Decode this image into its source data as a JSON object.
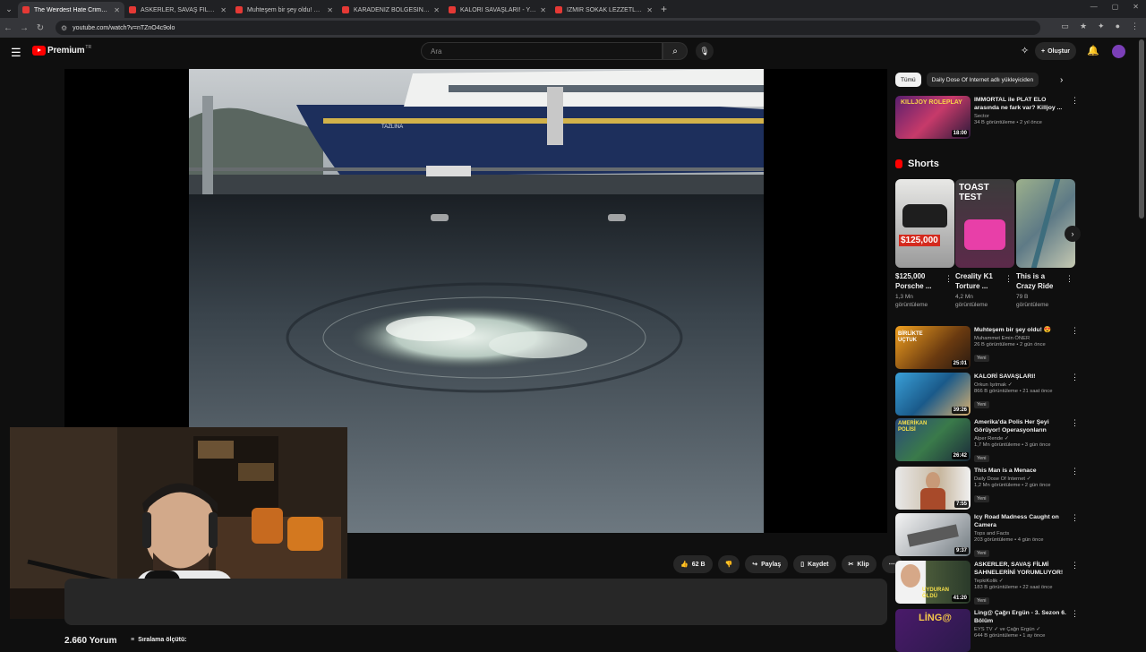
{
  "browser": {
    "tabs": [
      {
        "title": "The Weirdest Hate Crime - YouTube",
        "active": true
      },
      {
        "title": "ASKERLER, SAVAŞ FİLMİ SAHNE",
        "active": false
      },
      {
        "title": "Muhteşem bir şey oldu! 😍 - YouTube",
        "active": false
      },
      {
        "title": "KARADENİZ BÖLGESİNİN EN Ç",
        "active": false
      },
      {
        "title": "KALORİ SAVAŞLARI! - YouTube",
        "active": false
      },
      {
        "title": "İZMİR SOKAK LEZZETLERİ - You",
        "active": false
      }
    ],
    "url": "youtube.com/watch?v=nTZnO4c9olo"
  },
  "header": {
    "logo_text": "Premium",
    "logo_sup": "TR",
    "search_placeholder": "Ara",
    "create_label": "Oluştur"
  },
  "video": {
    "ship_name": "TAZLINA",
    "likes": "62 B",
    "share_label": "Paylaş",
    "save_label": "Kaydet",
    "clip_label": "Klip",
    "comments_count": "2.660 Yorum",
    "sort_label": "Sıralama ölçütü:"
  },
  "sidebar": {
    "chips": [
      "Tümü",
      "Daily Dose Of Internet adlı yükleyiciden"
    ],
    "top_rec": {
      "title": "IMMORTAL ile PLAT ELO arasında ne fark var? Killjoy ...",
      "channel": "Sector",
      "meta": "34 B görüntüleme • 2 yıl önce",
      "duration": "18:00",
      "thumb_text": "KILLJOY ROLEPLAY"
    },
    "shorts_title": "Shorts",
    "shorts": [
      {
        "title": "$125,000 Porsche ...",
        "views": "1,3 Mn görüntüleme",
        "thumb_text": "$125,000"
      },
      {
        "title": "Creality K1 Torture ...",
        "views": "4,2 Mn görüntüleme",
        "thumb_text": "TOAST TEST"
      },
      {
        "title": "This is a Crazy Ride",
        "views": "79 B görüntüleme",
        "thumb_text": ""
      }
    ],
    "recs": [
      {
        "title": "Muhteşem bir şey oldu! 😍",
        "channel": "Muhammet Emin ÖNER",
        "meta": "26 B görüntüleme • 2 gün önce",
        "badge": "Yeni",
        "duration": "25:01",
        "thumb_text": "BİRLİKTE UÇTUK"
      },
      {
        "title": "KALORİ SAVAŞLARI!",
        "channel": "Orkun Işıtmak ✓",
        "meta": "866 B görüntüleme • 21 saat önce",
        "badge": "Yeni",
        "duration": "39:26",
        "thumb_text": ""
      },
      {
        "title": "Amerika'da Polis Her Şeyi Görüyor! Operasyonların Perde...",
        "channel": "Alper Rende ✓",
        "meta": "1,7 Mn görüntüleme • 3 gün önce",
        "badge": "Yeni",
        "duration": "26:42",
        "thumb_text": "AMERİKAN POLİSİ"
      },
      {
        "title": "This Man is a Menace",
        "channel": "Daily Dose Of Internet ✓",
        "meta": "1,2 Mn görüntüleme • 2 gün önce",
        "badge": "Yeni",
        "duration": "7:55",
        "thumb_text": ""
      },
      {
        "title": "Icy Road Madness Caught on Camera",
        "channel": "Tops and Facts",
        "meta": "203 görüntüleme • 4 gün önce",
        "badge": "Yeni",
        "duration": "9:37",
        "thumb_text": ""
      },
      {
        "title": "ASKERLER, SAVAŞ FİLMİ SAHNELERİNİ YORUMLUYOR!",
        "channel": "TepkiKolik ✓",
        "meta": "183 B görüntüleme • 22 saat önce",
        "badge": "Yeni",
        "duration": "41:20",
        "thumb_text": "UYDURAN ÖLDÜ"
      },
      {
        "title": "Ling@ Çağrı Ergün - 3. Sezon 6. Bölüm",
        "channel": "EYS TV ✓ ve Çağrı Ergün ✓",
        "meta": "644 B görüntüleme • 1 ay önce",
        "badge": "",
        "duration": "",
        "thumb_text": "LİNG@"
      }
    ]
  },
  "colors": {
    "bg": "#0f0f0f",
    "accent": "#ff0000",
    "pill": "#272727"
  }
}
